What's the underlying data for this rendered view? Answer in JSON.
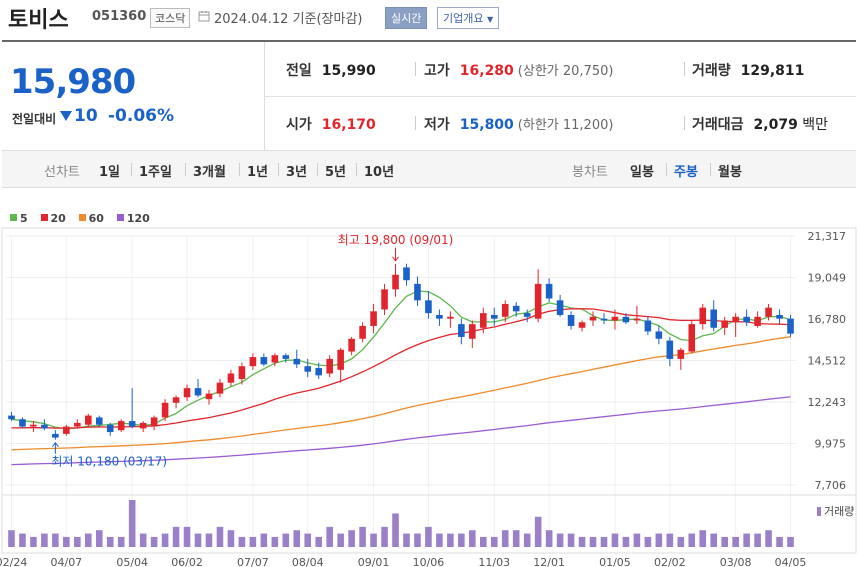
{
  "header": {
    "stock_name": "토비스",
    "stock_code": "051360",
    "market": "코스닥",
    "date_text": "2024.04.12 기준(장마감)",
    "realtime_label": "실시간",
    "company_label": "기업개요",
    "calendar_icon": "calendar-icon"
  },
  "quote": {
    "price": "15,980",
    "prev_label": "전일대비",
    "change": "10",
    "change_rate": "-0.06%",
    "change_direction": "down",
    "prev_close_label": "전일",
    "prev_close": "15,990",
    "high_label": "고가",
    "high": "16,280",
    "upper_limit": "(상한가 20,750)",
    "volume_label": "거래량",
    "volume": "129,811",
    "open_label": "시가",
    "open": "16,170",
    "low_label": "저가",
    "low": "15,800",
    "lower_limit": "(하한가 11,200)",
    "amount_label": "거래대금",
    "amount": "2,079",
    "amount_unit": "백만",
    "colors": {
      "up": "#e0262c",
      "down": "#1a61c8"
    }
  },
  "period_bar": {
    "line_label": "선차트",
    "line_items": [
      "1일",
      "1주일",
      "3개월",
      "1년",
      "3년",
      "5년",
      "10년"
    ],
    "candle_label": "봉차트",
    "candle_items": [
      "일봉",
      "주봉",
      "월봉"
    ],
    "candle_selected": "주봉"
  },
  "chart_data": {
    "type": "candlestick",
    "legend": [
      {
        "name": "5",
        "color": "#5cb84a"
      },
      {
        "name": "20",
        "color": "#e0262c"
      },
      {
        "name": "60",
        "color": "#f08a2a"
      },
      {
        "name": "120",
        "color": "#9a5cd2"
      }
    ],
    "y_ticks": [
      "21,317",
      "19,049",
      "16,780",
      "14,512",
      "12,243",
      "9,975",
      "7,706"
    ],
    "ylim": [
      7706,
      21317
    ],
    "x_ticks": [
      "02/24",
      "04/07",
      "05/04",
      "06/02",
      "07/07",
      "08/04",
      "09/01",
      "10/06",
      "11/03",
      "12/01",
      "01/05",
      "02/02",
      "03/08",
      "04/05"
    ],
    "annotations": {
      "max": {
        "text": "최고 19,800 (09/01)",
        "value": 19800
      },
      "min": {
        "text": "최저 10,180 (03/17)",
        "value": 10180
      }
    },
    "volume_label": "거래량",
    "candles": [
      [
        11500,
        11700,
        11200,
        11300
      ],
      [
        11300,
        11400,
        10800,
        10900
      ],
      [
        10900,
        11200,
        10600,
        11000
      ],
      [
        11000,
        11300,
        10700,
        10800
      ],
      [
        10500,
        10700,
        10180,
        10300
      ],
      [
        10500,
        11000,
        10400,
        10900
      ],
      [
        10900,
        11300,
        10800,
        11100
      ],
      [
        11000,
        11600,
        10900,
        11500
      ],
      [
        11400,
        11500,
        10900,
        11000
      ],
      [
        11000,
        11100,
        10400,
        10600
      ],
      [
        10700,
        11300,
        10600,
        11200
      ],
      [
        11200,
        13000,
        10800,
        10900
      ],
      [
        10800,
        11200,
        10600,
        11100
      ],
      [
        10900,
        11500,
        10700,
        11400
      ],
      [
        11400,
        12400,
        11200,
        12200
      ],
      [
        12200,
        12600,
        11900,
        12500
      ],
      [
        12500,
        13200,
        12300,
        13000
      ],
      [
        13000,
        13500,
        12500,
        12600
      ],
      [
        12400,
        12900,
        12100,
        12700
      ],
      [
        12700,
        13500,
        12500,
        13300
      ],
      [
        13300,
        14000,
        13100,
        13800
      ],
      [
        13500,
        14400,
        13200,
        14200
      ],
      [
        14200,
        14900,
        14000,
        14700
      ],
      [
        14700,
        14900,
        14200,
        14300
      ],
      [
        14400,
        14900,
        14200,
        14800
      ],
      [
        14800,
        14900,
        14400,
        14600
      ],
      [
        14600,
        15100,
        14100,
        14300
      ],
      [
        14200,
        14600,
        13600,
        13900
      ],
      [
        14100,
        14400,
        13500,
        13700
      ],
      [
        13800,
        14800,
        13600,
        14600
      ],
      [
        14000,
        15200,
        13300,
        15100
      ],
      [
        15000,
        15800,
        14800,
        15700
      ],
      [
        15700,
        16600,
        15500,
        16400
      ],
      [
        16400,
        17600,
        16000,
        17200
      ],
      [
        17300,
        18700,
        17000,
        18400
      ],
      [
        18400,
        19800,
        18000,
        19200
      ],
      [
        19600,
        19800,
        18600,
        18900
      ],
      [
        18700,
        19100,
        17500,
        17800
      ],
      [
        17800,
        18300,
        16800,
        17100
      ],
      [
        17000,
        17300,
        16400,
        16800
      ],
      [
        16800,
        17200,
        16300,
        16900
      ],
      [
        16500,
        16800,
        15400,
        15800
      ],
      [
        15700,
        16700,
        15200,
        16500
      ],
      [
        16300,
        17400,
        16000,
        17100
      ],
      [
        17000,
        17400,
        16400,
        16800
      ],
      [
        16900,
        17800,
        16600,
        17600
      ],
      [
        17500,
        17700,
        16900,
        17200
      ],
      [
        17100,
        17300,
        16600,
        16900
      ],
      [
        16800,
        19500,
        16600,
        18700
      ],
      [
        18700,
        19000,
        17700,
        17900
      ],
      [
        17800,
        18100,
        16900,
        17000
      ],
      [
        17000,
        17200,
        16200,
        16400
      ],
      [
        16300,
        16700,
        16100,
        16600
      ],
      [
        16700,
        17200,
        16400,
        16900
      ],
      [
        16800,
        17100,
        16500,
        16700
      ],
      [
        16700,
        17300,
        16200,
        16900
      ],
      [
        16900,
        17100,
        16500,
        16600
      ],
      [
        16700,
        17500,
        16500,
        16800
      ],
      [
        16700,
        16900,
        15900,
        16100
      ],
      [
        16100,
        16400,
        15400,
        15700
      ],
      [
        15600,
        15800,
        14200,
        14600
      ],
      [
        14600,
        15200,
        14000,
        15100
      ],
      [
        15000,
        16700,
        14900,
        16500
      ],
      [
        16500,
        17600,
        16200,
        17400
      ],
      [
        17300,
        17800,
        16100,
        16300
      ],
      [
        16300,
        16900,
        15900,
        16700
      ],
      [
        16600,
        17100,
        15800,
        16900
      ],
      [
        16900,
        17300,
        16400,
        16600
      ],
      [
        16400,
        17200,
        16300,
        16900
      ],
      [
        16900,
        17600,
        16700,
        17400
      ],
      [
        17000,
        17300,
        16500,
        16800
      ],
      [
        16800,
        17000,
        15800,
        15980
      ]
    ],
    "volumes": [
      5,
      4,
      3,
      4,
      4,
      3,
      3,
      4,
      5,
      3,
      3,
      14,
      4,
      3,
      4,
      6,
      6,
      4,
      4,
      6,
      5,
      3,
      3,
      4,
      3,
      4,
      5,
      4,
      3,
      6,
      4,
      5,
      6,
      4,
      6,
      10,
      4,
      4,
      6,
      4,
      4,
      4,
      5,
      3,
      3,
      5,
      5,
      4,
      9,
      5,
      4,
      4,
      3,
      3,
      3,
      4,
      3,
      4,
      3,
      4,
      4,
      3,
      4,
      5,
      4,
      3,
      3,
      4,
      4,
      5,
      3,
      3
    ]
  }
}
